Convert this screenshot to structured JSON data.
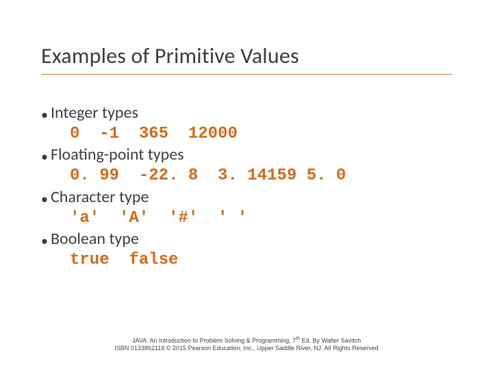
{
  "title": "Examples of Primitive Values",
  "bullets": [
    {
      "label": "Integer types",
      "example": "0  -1  365  12000"
    },
    {
      "label": "Floating-point types",
      "example": "0. 99  -22. 8  3. 14159 5. 0"
    },
    {
      "label": "Character type",
      "example": "'a'  'A'  '#'  ' '"
    },
    {
      "label": "Boolean type",
      "example": "true  false"
    }
  ],
  "footer": {
    "line1a": "JAVA: An Introduction to Problem Solving & Programming, 7",
    "line1sup": "th",
    "line1b": " Ed. By Walter Savitch",
    "line2": "ISBN 0133862119 © 2015 Pearson Education, Inc., Upper Saddle River, NJ. All Rights Reserved"
  }
}
